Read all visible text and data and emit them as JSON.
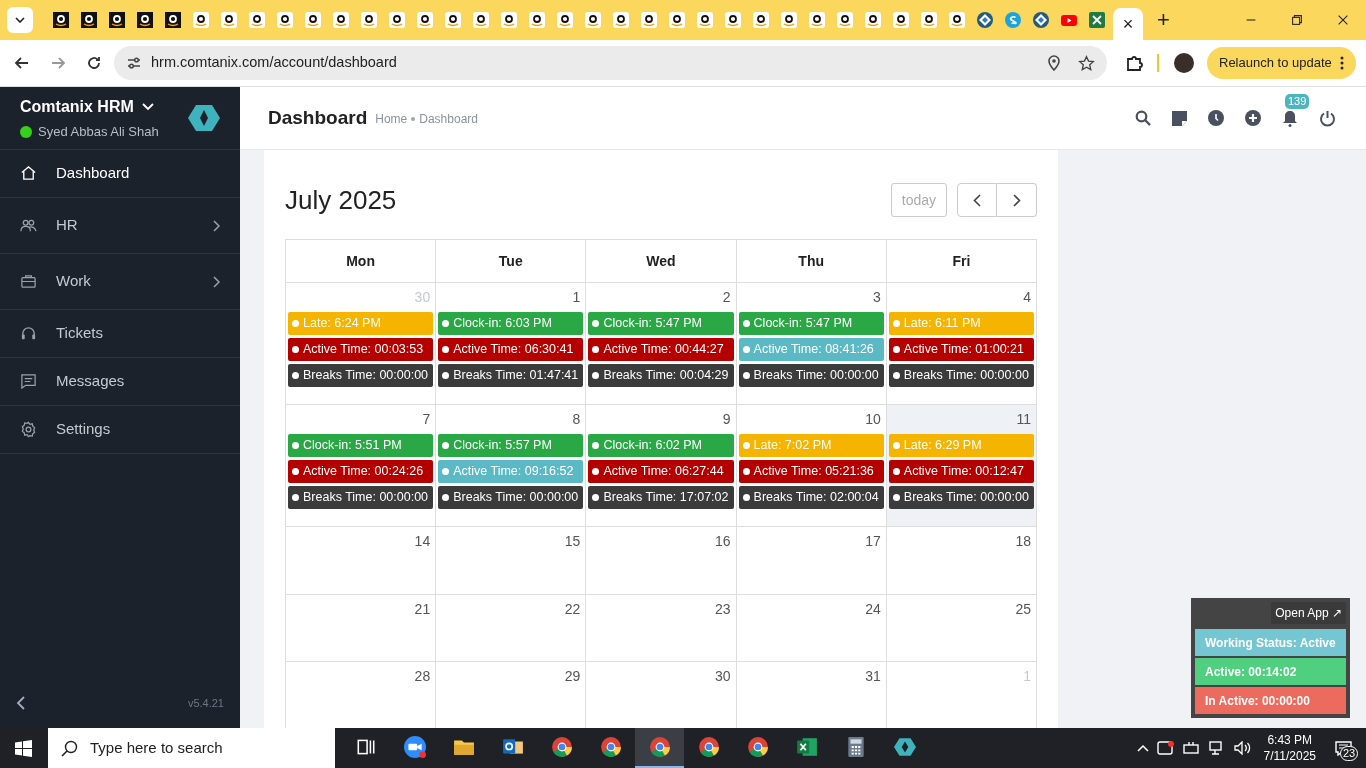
{
  "browser": {
    "tabs": [
      {
        "kind": "amazondark",
        "selected": false
      },
      {
        "kind": "amazondark",
        "selected": false
      },
      {
        "kind": "amazondark",
        "selected": false
      },
      {
        "kind": "amazondark",
        "selected": false
      },
      {
        "kind": "amazondark",
        "selected": false
      },
      {
        "kind": "amazon",
        "selected": false
      },
      {
        "kind": "amazon",
        "selected": false
      },
      {
        "kind": "amazon",
        "selected": false
      },
      {
        "kind": "amazon",
        "selected": false
      },
      {
        "kind": "amazon",
        "selected": false
      },
      {
        "kind": "amazon",
        "selected": false
      },
      {
        "kind": "amazon",
        "selected": false
      },
      {
        "kind": "amazon",
        "selected": false
      },
      {
        "kind": "amazon",
        "selected": false
      },
      {
        "kind": "amazon",
        "selected": false
      },
      {
        "kind": "amazon",
        "selected": false
      },
      {
        "kind": "amazon",
        "selected": false
      },
      {
        "kind": "amazon",
        "selected": false
      },
      {
        "kind": "amazon",
        "selected": false
      },
      {
        "kind": "amazon",
        "selected": false
      },
      {
        "kind": "amazon",
        "selected": false
      },
      {
        "kind": "amazon",
        "selected": false
      },
      {
        "kind": "amazon",
        "selected": false
      },
      {
        "kind": "amazon",
        "selected": false
      },
      {
        "kind": "amazon",
        "selected": false
      },
      {
        "kind": "amazon",
        "selected": false
      },
      {
        "kind": "amazon",
        "selected": false
      },
      {
        "kind": "amazon",
        "selected": false
      },
      {
        "kind": "amazon",
        "selected": false
      },
      {
        "kind": "amazon",
        "selected": false
      },
      {
        "kind": "amazon",
        "selected": false
      },
      {
        "kind": "amazon",
        "selected": false
      },
      {
        "kind": "amazon",
        "selected": false
      },
      {
        "kind": "diamond",
        "selected": false
      },
      {
        "kind": "skype",
        "selected": false
      },
      {
        "kind": "diamond",
        "selected": false
      },
      {
        "kind": "youtube",
        "selected": false
      },
      {
        "kind": "excel",
        "selected": false
      },
      {
        "kind": "page",
        "selected": true
      }
    ],
    "close_tab": "×",
    "new_tab": "+",
    "url": "hrm.comtanix.com/account/dashboard",
    "relaunch": "Relaunch to update"
  },
  "sidebar": {
    "app_name": "Comtanix HRM",
    "user": "Syed Abbas Ali Shah",
    "online": true,
    "items": [
      {
        "label": "Dashboard",
        "kind": "home",
        "selected": true,
        "expandable": false
      },
      {
        "label": "HR",
        "kind": "people",
        "selected": false,
        "expandable": true
      },
      {
        "label": "Work",
        "kind": "briefcase",
        "selected": false,
        "expandable": true
      },
      {
        "label": "Tickets",
        "kind": "headset",
        "selected": false,
        "expandable": false
      },
      {
        "label": "Messages",
        "kind": "message",
        "selected": false,
        "expandable": false
      },
      {
        "label": "Settings",
        "kind": "gear",
        "selected": false,
        "expandable": false
      }
    ],
    "version": "v5.4.21"
  },
  "header": {
    "title": "Dashboard",
    "breadcrumb": [
      "Home",
      "Dashboard"
    ],
    "notification_count": "139"
  },
  "calendar": {
    "title": "July 2025",
    "today_button": "today",
    "columns": [
      "Mon",
      "Tue",
      "Wed",
      "Thu",
      "Fri"
    ],
    "weeks": [
      [
        {
          "day": "30",
          "muted": true,
          "today": false,
          "events": [
            {
              "text": "Late: 6:24 PM",
              "color": "#f4b400"
            },
            {
              "text": "Active Time: 00:03:53",
              "color": "#b50000"
            },
            {
              "text": "Breaks Time: 00:00:00",
              "color": "#3b3b3b"
            }
          ]
        },
        {
          "day": "1",
          "muted": false,
          "today": false,
          "events": [
            {
              "text": "Clock-in: 6:03 PM",
              "color": "#2aa845"
            },
            {
              "text": "Active Time: 06:30:41",
              "color": "#b50000"
            },
            {
              "text": "Breaks Time: 01:47:41",
              "color": "#3b3b3b"
            }
          ]
        },
        {
          "day": "2",
          "muted": false,
          "today": false,
          "events": [
            {
              "text": "Clock-in: 5:47 PM",
              "color": "#2aa845"
            },
            {
              "text": "Active Time: 00:44:27",
              "color": "#b50000"
            },
            {
              "text": "Breaks Time: 00:04:29",
              "color": "#3b3b3b"
            }
          ]
        },
        {
          "day": "3",
          "muted": false,
          "today": false,
          "events": [
            {
              "text": "Clock-in: 5:47 PM",
              "color": "#2aa845"
            },
            {
              "text": "Active Time: 08:41:26",
              "color": "#5bb9c5"
            },
            {
              "text": "Breaks Time: 00:00:00",
              "color": "#3b3b3b"
            }
          ]
        },
        {
          "day": "4",
          "muted": false,
          "today": false,
          "events": [
            {
              "text": "Late: 6:11 PM",
              "color": "#f4b400"
            },
            {
              "text": "Active Time: 01:00:21",
              "color": "#b50000"
            },
            {
              "text": "Breaks Time: 00:00:00",
              "color": "#3b3b3b"
            }
          ]
        }
      ],
      [
        {
          "day": "7",
          "muted": false,
          "today": false,
          "events": [
            {
              "text": "Clock-in: 5:51 PM",
              "color": "#2aa845"
            },
            {
              "text": "Active Time: 00:24:26",
              "color": "#b50000"
            },
            {
              "text": "Breaks Time: 00:00:00",
              "color": "#3b3b3b"
            }
          ]
        },
        {
          "day": "8",
          "muted": false,
          "today": false,
          "events": [
            {
              "text": "Clock-in: 5:57 PM",
              "color": "#2aa845"
            },
            {
              "text": "Active Time: 09:16:52",
              "color": "#5bb9c5"
            },
            {
              "text": "Breaks Time: 00:00:00",
              "color": "#3b3b3b"
            }
          ]
        },
        {
          "day": "9",
          "muted": false,
          "today": false,
          "events": [
            {
              "text": "Clock-in: 6:02 PM",
              "color": "#2aa845"
            },
            {
              "text": "Active Time: 06:27:44",
              "color": "#b50000"
            },
            {
              "text": "Breaks Time: 17:07:02",
              "color": "#3b3b3b"
            }
          ]
        },
        {
          "day": "10",
          "muted": false,
          "today": false,
          "events": [
            {
              "text": "Late: 7:02 PM",
              "color": "#f4b400"
            },
            {
              "text": "Active Time: 05:21:36",
              "color": "#b50000"
            },
            {
              "text": "Breaks Time: 02:00:04",
              "color": "#3b3b3b"
            }
          ]
        },
        {
          "day": "11",
          "muted": false,
          "today": true,
          "events": [
            {
              "text": "Late: 6:29 PM",
              "color": "#f4b400"
            },
            {
              "text": "Active Time: 00:12:47",
              "color": "#b50000"
            },
            {
              "text": "Breaks Time: 00:00:00",
              "color": "#3b3b3b"
            }
          ]
        }
      ],
      [
        {
          "day": "14",
          "muted": false,
          "today": false
        },
        {
          "day": "15",
          "muted": false,
          "today": false
        },
        {
          "day": "16",
          "muted": false,
          "today": false
        },
        {
          "day": "17",
          "muted": false,
          "today": false
        },
        {
          "day": "18",
          "muted": false,
          "today": false
        }
      ],
      [
        {
          "day": "21",
          "muted": false,
          "today": false
        },
        {
          "day": "22",
          "muted": false,
          "today": false
        },
        {
          "day": "23",
          "muted": false,
          "today": false
        },
        {
          "day": "24",
          "muted": false,
          "today": false
        },
        {
          "day": "25",
          "muted": false,
          "today": false
        }
      ],
      [
        {
          "day": "28",
          "muted": false,
          "today": false
        },
        {
          "day": "29",
          "muted": false,
          "today": false
        },
        {
          "day": "30",
          "muted": false,
          "today": false
        },
        {
          "day": "31",
          "muted": false,
          "today": false
        },
        {
          "day": "1",
          "muted": true,
          "today": false
        }
      ]
    ]
  },
  "tracker": {
    "open_app": "Open App ↗",
    "rows": [
      {
        "text": "Working Status: Active",
        "color": "#74c7d2"
      },
      {
        "text": "Active: 00:14:02",
        "color": "#4fcf7f"
      },
      {
        "text": "In Active: 00:00:00",
        "color": "#ec6b5e"
      }
    ]
  },
  "taskbar": {
    "search_placeholder": "Type here to search",
    "apps": [
      {
        "kind": "taskview",
        "selected": false
      },
      {
        "kind": "zoom",
        "selected": false
      },
      {
        "kind": "explorer",
        "selected": false
      },
      {
        "kind": "outlook",
        "selected": false
      },
      {
        "kind": "chrome",
        "selected": false
      },
      {
        "kind": "chrome",
        "selected": false
      },
      {
        "kind": "chrome",
        "selected": true
      },
      {
        "kind": "chrome",
        "selected": false
      },
      {
        "kind": "chrome",
        "selected": false
      },
      {
        "kind": "excel",
        "selected": false
      },
      {
        "kind": "calculator",
        "selected": false
      },
      {
        "kind": "diamond",
        "selected": false
      }
    ],
    "time": "6:43 PM",
    "date": "7/11/2025",
    "notifications": "23"
  }
}
